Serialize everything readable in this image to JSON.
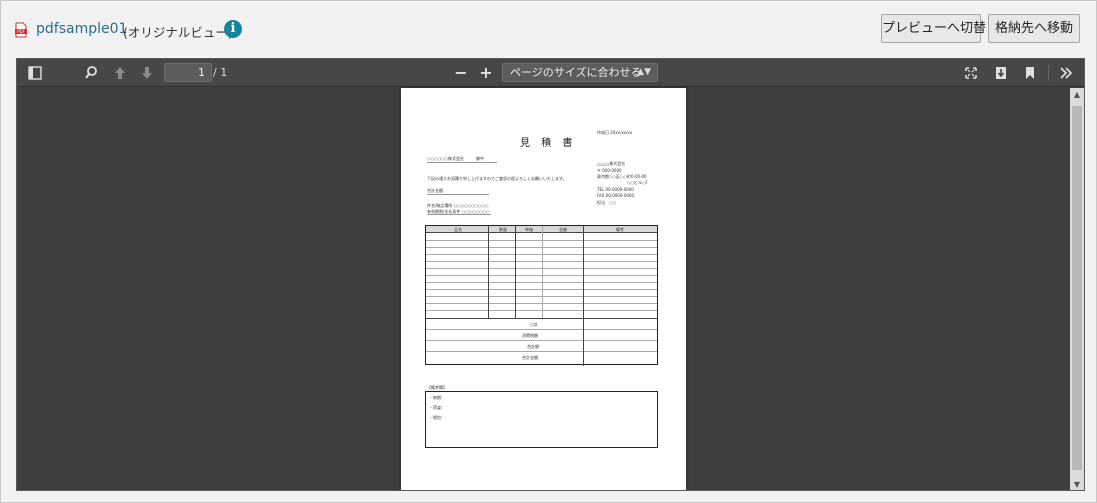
{
  "header": {
    "file_name": "pdfsample01",
    "view_mode": "(オリジナルビュー)",
    "info_icon": "info-icon",
    "buttons": {
      "preview": "プレビューへ切替",
      "move": "格納先へ移動"
    }
  },
  "viewer": {
    "page_input": "1",
    "page_total": "/ 1",
    "zoom_out": "−",
    "zoom_in": "+",
    "zoom_select": "ページのサイズに合わせる",
    "icons": [
      "sidebar-toggle-icon",
      "search-icon",
      "prev-page-icon",
      "next-page-icon",
      "presentation-mode-icon",
      "download-icon",
      "bookmark-icon",
      "tools-icon"
    ]
  },
  "document": {
    "title": "見 積 書",
    "date_label": "作成日 20xx/xx/xx",
    "customer": "○○○○○○株式会社　　　御中",
    "intro": "下記の通りお見積り申し上げますのでご査収の程よろしくお願いいたします。",
    "total_label": "合計金額",
    "subject": "件名/納品場所 ○○○○○○○○○○",
    "deadline": "有効期限/支払条件 ○○○○○○○○",
    "company": "△△△△株式会社",
    "company_lines": [
      "〒 000-0000",
      "東京都○○区○○町0-00-00",
      "○○ビル○F",
      "TEL 00-0000-0000",
      "FAX 00-0000-0000"
    ],
    "contact": "担当　○○",
    "table_headers": [
      "品名",
      "数量",
      "単価",
      "金額",
      "備考"
    ],
    "summary_rows": [
      "小計",
      "消費税額",
      "合計額",
      "合計金額"
    ],
    "notes_title": "【備考欄】",
    "notes_items": [
      "・納期：",
      "・荷姿：",
      "・梱包："
    ]
  },
  "colors": {
    "link": "#2a6a94",
    "info": "#17849d",
    "viewer_bg": "#404040",
    "toolbar_bg": "#474747"
  }
}
